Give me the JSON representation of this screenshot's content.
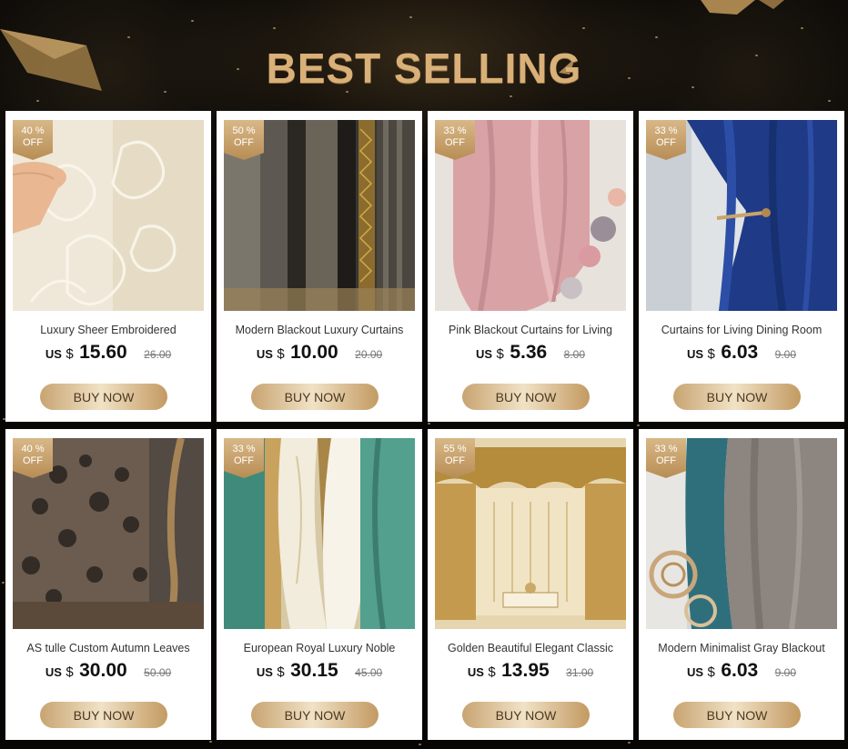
{
  "header": {
    "title": "BEST SELLING"
  },
  "colors": {
    "accent_gold": "#d9b078",
    "button_gold": "#c8a472",
    "background": "#070605"
  },
  "products": [
    {
      "discount": "40 %",
      "off": "OFF",
      "name": "Luxury Sheer Embroidered",
      "currency": "US",
      "dollar": "$",
      "price": "15.60",
      "original_price": "26.00",
      "button": "BUY NOW"
    },
    {
      "discount": "50 %",
      "off": "OFF",
      "name": "Modern Blackout Luxury Curtains",
      "currency": "US",
      "dollar": "$",
      "price": "10.00",
      "original_price": "20.00",
      "button": "BUY NOW"
    },
    {
      "discount": "33 %",
      "off": "OFF",
      "name": "Pink Blackout Curtains for Living",
      "currency": "US",
      "dollar": "$",
      "price": "5.36",
      "original_price": "8.00",
      "button": "BUY NOW"
    },
    {
      "discount": "33 %",
      "off": "OFF",
      "name": "Curtains for Living Dining Room",
      "currency": "US",
      "dollar": "$",
      "price": "6.03",
      "original_price": "9.00",
      "button": "BUY NOW"
    },
    {
      "discount": "40 %",
      "off": "OFF",
      "name": "AS tulle Custom Autumn Leaves",
      "currency": "US",
      "dollar": "$",
      "price": "30.00",
      "original_price": "50.00",
      "button": "BUY NOW"
    },
    {
      "discount": "33 %",
      "off": "OFF",
      "name": "European Royal Luxury Noble",
      "currency": "US",
      "dollar": "$",
      "price": "30.15",
      "original_price": "45.00",
      "button": "BUY NOW"
    },
    {
      "discount": "55 %",
      "off": "OFF",
      "name": "Golden Beautiful Elegant Classic",
      "currency": "US",
      "dollar": "$",
      "price": "13.95",
      "original_price": "31.00",
      "button": "BUY NOW"
    },
    {
      "discount": "33 %",
      "off": "OFF",
      "name": "Modern Minimalist Gray Blackout",
      "currency": "US",
      "dollar": "$",
      "price": "6.03",
      "original_price": "9.00",
      "button": "BUY NOW"
    }
  ]
}
